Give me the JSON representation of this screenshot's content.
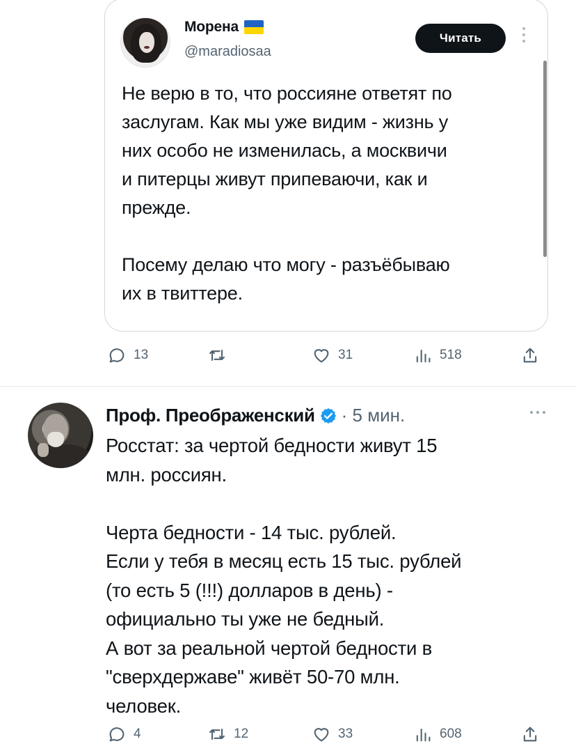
{
  "quoted_tweet": {
    "author_name": "Морена",
    "flag": "ukraine-flag",
    "handle": "@maradiosaa",
    "follow_label": "Читать",
    "text": "Не верю в то, что россияне ответят по\nзаслугам. Как мы уже видим - жизнь у\nних особо не изменилась, а москвичи\nи питерцы живут припеваючи, как и\nпрежде.\n\nПосему делаю что могу - разъёбываю\nих в твиттере.",
    "stats": {
      "replies": "13",
      "retweets": "",
      "likes": "31",
      "views": "518"
    }
  },
  "tweet": {
    "author_name": "Проф. Преображенский",
    "verified": true,
    "time": "· 5 мин.",
    "text": "Росстат: за чертой бедности живут 15\nмлн. россиян.\n\nЧерта бедности - 14 тыс. рублей.\nЕсли у тебя в месяц есть 15 тыс. рублей\n(то есть 5 (!!!) долларов в день) -\nофициально ты уже не бедный.\nА вот за реальной чертой бедности в\n\"сверхдержаве\" живёт 50-70 млн.\nчеловек.",
    "stats": {
      "replies": "4",
      "retweets": "12",
      "likes": "33",
      "views": "608"
    }
  },
  "colors": {
    "text": "#0f1419",
    "secondary": "#536471",
    "border": "#cfd9de",
    "verified": "#1d9bf0",
    "button": "#0f1419"
  }
}
